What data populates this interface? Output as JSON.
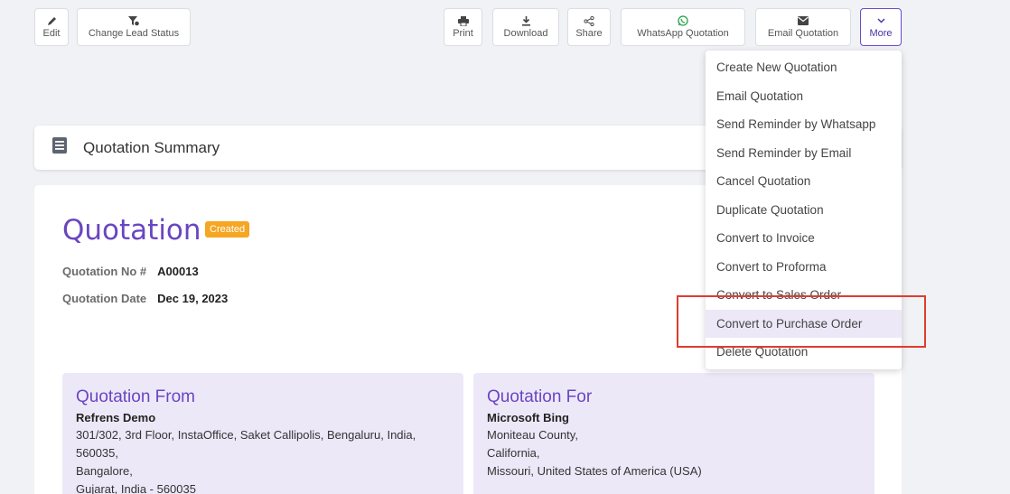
{
  "toolbar": {
    "edit": "Edit",
    "change_status": "Change Lead Status",
    "print": "Print",
    "download": "Download",
    "share": "Share",
    "whatsapp": "WhatsApp Quotation",
    "email": "Email Quotation",
    "more": "More"
  },
  "summary": {
    "title": "Quotation Summary"
  },
  "document": {
    "title": "Quotation",
    "status": "Created",
    "number_label": "Quotation No #",
    "number": "A00013",
    "date_label": "Quotation Date",
    "date": "Dec 19, 2023"
  },
  "from": {
    "heading": "Quotation From",
    "name": "Refrens Demo",
    "lines": [
      "301/302, 3rd Floor, InstaOffice, Saket Callipolis, Bengaluru, India,",
      "560035,",
      "Bangalore,",
      "Gujarat, India - 560035"
    ]
  },
  "for": {
    "heading": "Quotation For",
    "name": "Microsoft Bing",
    "lines": [
      "Moniteau County,",
      "California,",
      "Missouri, United States of America (USA)"
    ]
  },
  "menu": {
    "items": [
      "Create New Quotation",
      "Email Quotation",
      "Send Reminder by Whatsapp",
      "Send Reminder by Email",
      "Cancel Quotation",
      "Duplicate Quotation",
      "Convert to Invoice",
      "Convert to Proforma",
      "Convert to Sales Order",
      "Convert to Purchase Order",
      "Delete Quotation"
    ]
  },
  "colors": {
    "accent": "#6a45c2",
    "badge": "#f5a623",
    "highlight": "#e03c2e"
  }
}
